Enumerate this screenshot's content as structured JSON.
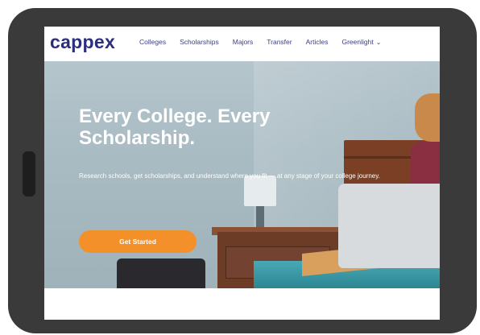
{
  "brand": {
    "logo_text": "cappex",
    "logo_color": "#2b2f7d"
  },
  "nav": {
    "links": [
      "Colleges",
      "Scholarships",
      "Majors",
      "Transfer",
      "Articles",
      "Greenlight"
    ],
    "dropdown_icon": "chevron-down-icon"
  },
  "hero": {
    "title": "Every College. Every Scholarship.",
    "subtitle": "Research schools, get scholarships, and understand where you fit — at any stage of your college journey.",
    "cta_label": "Get Started",
    "cta_color": "#f4902a"
  },
  "device": {
    "frame_color": "#3a3a3a"
  }
}
